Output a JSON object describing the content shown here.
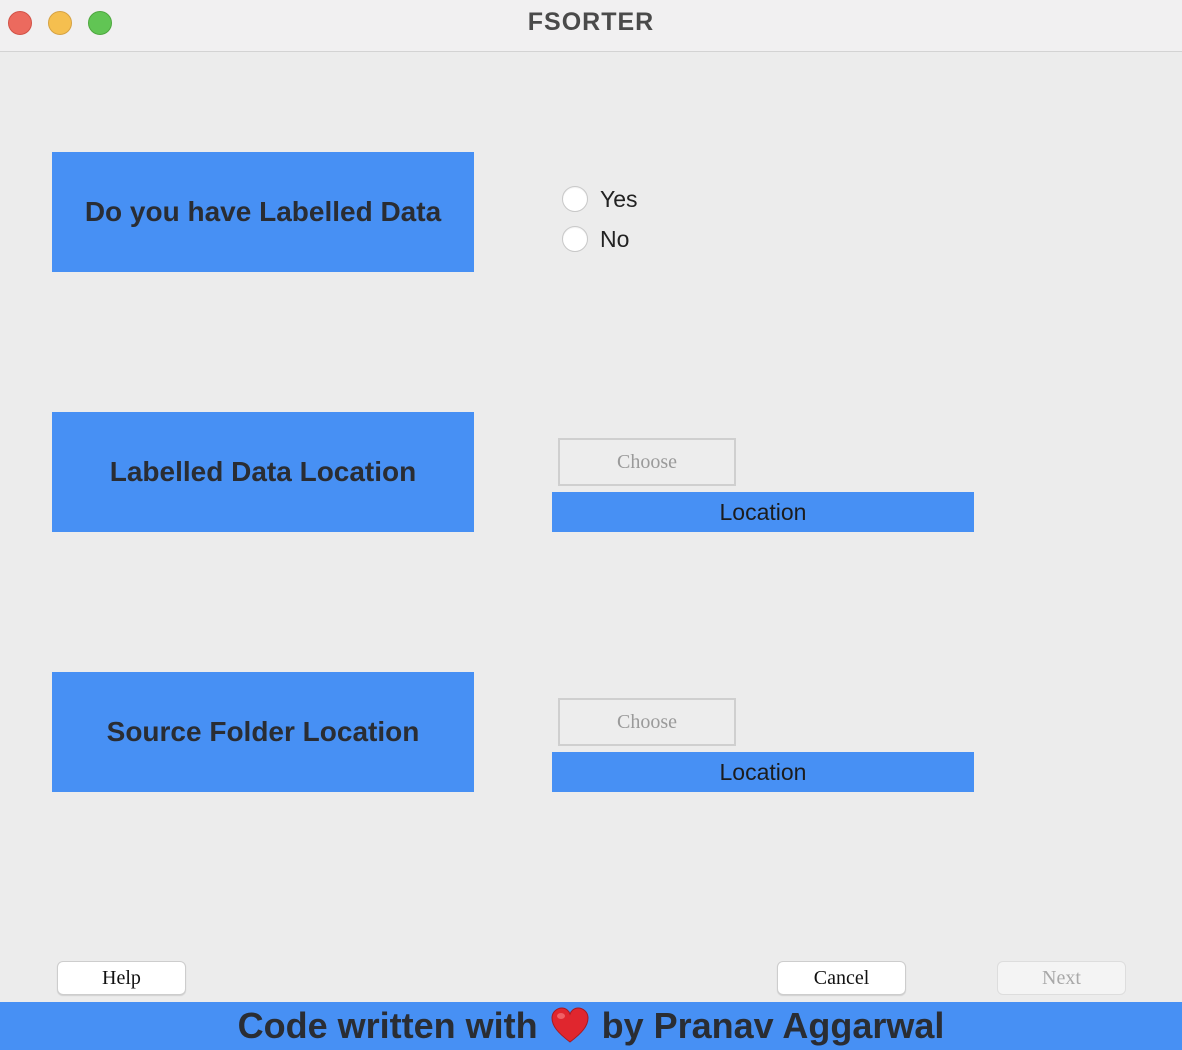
{
  "window": {
    "title": "FSORTER"
  },
  "labelled_question": {
    "label": "Do you have Labelled Data",
    "options": [
      {
        "label": "Yes",
        "selected": false
      },
      {
        "label": "No",
        "selected": false
      }
    ]
  },
  "labelled_location": {
    "label": "Labelled Data Location",
    "choose_label": "Choose",
    "location_text": "Location"
  },
  "source_location": {
    "label": "Source Folder Location",
    "choose_label": "Choose",
    "location_text": "Location"
  },
  "buttons": {
    "help": "Help",
    "cancel": "Cancel",
    "next": "Next"
  },
  "footer": {
    "prefix": "Code written with",
    "heart_icon": "heart-icon",
    "suffix": "by Pranav Aggarwal"
  },
  "colors": {
    "accent": "#4790f4",
    "background": "#ececec"
  }
}
